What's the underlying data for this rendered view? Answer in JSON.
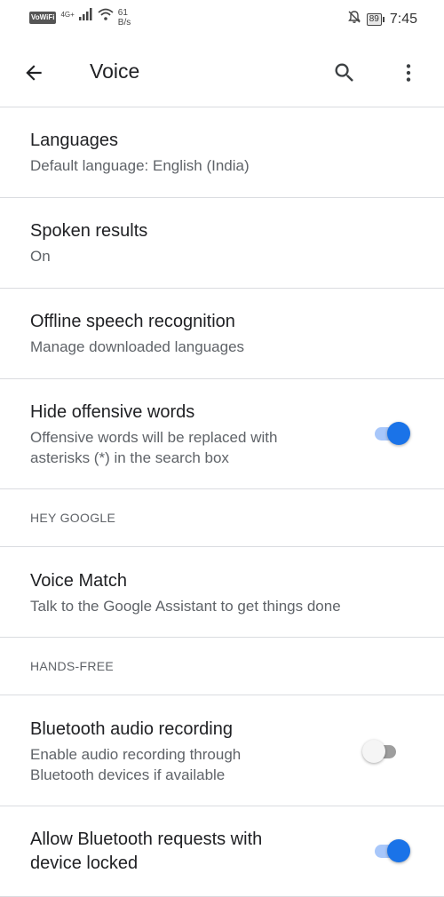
{
  "status_bar": {
    "vowifi": "VoWiFi",
    "net_type": "4G+",
    "speed_value": "61",
    "speed_unit": "B/s",
    "battery": "89",
    "time": "7:45"
  },
  "app_bar": {
    "title": "Voice"
  },
  "settings": {
    "languages": {
      "title": "Languages",
      "subtitle": "Default language: English (India)"
    },
    "spoken_results": {
      "title": "Spoken results",
      "subtitle": "On"
    },
    "offline_speech": {
      "title": "Offline speech recognition",
      "subtitle": "Manage downloaded languages"
    },
    "hide_offensive": {
      "title": "Hide offensive words",
      "subtitle_line1": "Offensive words will be replaced with",
      "subtitle_line2": "asterisks (*) in the search box",
      "enabled": true
    },
    "hey_google_header": "HEY GOOGLE",
    "voice_match": {
      "title": "Voice Match",
      "subtitle": "Talk to the Google Assistant to get things done"
    },
    "hands_free_header": "HANDS-FREE",
    "bluetooth_audio": {
      "title": "Bluetooth audio recording",
      "subtitle_line1": "Enable audio recording through",
      "subtitle_line2": "Bluetooth devices if available",
      "enabled": false
    },
    "bluetooth_locked": {
      "title_line1": "Allow Bluetooth requests with",
      "title_line2": "device locked",
      "enabled": true
    }
  },
  "colors": {
    "accent": "#1a73e8",
    "accent_track": "#a8c7fa",
    "divider": "#dadce0"
  },
  "icons": [
    "back-arrow-icon",
    "search-icon",
    "more-vert-icon",
    "notifications-off-icon",
    "wifi-icon",
    "signal-icon"
  ]
}
